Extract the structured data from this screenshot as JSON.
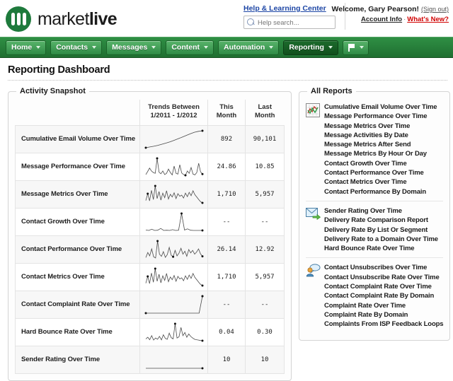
{
  "header": {
    "logo_text_light": "market",
    "logo_text_bold": "live",
    "logo_icon": "marketlive-circle-logo",
    "help_link": "Help & Learning Center",
    "help_search_placeholder": "Help search...",
    "help_search_value": "",
    "welcome": "Welcome, Gary Pearson!",
    "sign_out": "(Sign out)",
    "account_info": "Account Info",
    "separator": "·",
    "whats_new": "What's New?",
    "accent_green": "#1e7a3c",
    "link_blue": "#1d46a5",
    "alert_red": "#d00000"
  },
  "nav": {
    "items": [
      {
        "label": "Home",
        "active": false
      },
      {
        "label": "Contacts",
        "active": false
      },
      {
        "label": "Messages",
        "active": false
      },
      {
        "label": "Content",
        "active": false
      },
      {
        "label": "Automation",
        "active": false
      },
      {
        "label": "Reporting",
        "active": true
      }
    ],
    "flag_button": {
      "icon": "flag-icon",
      "label": ""
    }
  },
  "page": {
    "title": "Reporting Dashboard"
  },
  "activity_snapshot": {
    "legend": "Activity Snapshot",
    "columns": [
      "",
      "Trends Between 1/2011 - 1/2012",
      "This Month",
      "Last Month"
    ],
    "column_trend_line1": "Trends Between",
    "column_trend_line2": "1/2011 - 1/2012",
    "column_this_month": "This Month",
    "column_last_month": "Last Month",
    "rows": [
      {
        "name": "Cumulative Email Volume Over Time",
        "this_month": "892",
        "last_month": "90,101"
      },
      {
        "name": "Message Performance Over Time",
        "this_month": "24.86",
        "last_month": "10.85"
      },
      {
        "name": "Message Metrics Over Time",
        "this_month": "1,710",
        "last_month": "5,957"
      },
      {
        "name": "Contact Growth Over Time",
        "this_month": "--",
        "last_month": "--"
      },
      {
        "name": "Contact Performance Over Time",
        "this_month": "26.14",
        "last_month": "12.92"
      },
      {
        "name": "Contact Metrics Over Time",
        "this_month": "1,710",
        "last_month": "5,957"
      },
      {
        "name": "Contact Complaint Rate Over Time",
        "this_month": "--",
        "last_month": "--"
      },
      {
        "name": "Hard Bounce Rate Over Time",
        "this_month": "0.04",
        "last_month": "0.30"
      },
      {
        "name": "Sender Rating Over Time",
        "this_month": "10",
        "last_month": "10"
      }
    ]
  },
  "chart_data": [
    {
      "type": "line",
      "title": "Cumulative Email Volume Over Time",
      "xlabel": "",
      "ylabel": "",
      "values": [
        5,
        9,
        13,
        18,
        24,
        30,
        37,
        45,
        53,
        62,
        71,
        80,
        88,
        93,
        96
      ],
      "markers": {
        "first": 0,
        "last": 14
      }
    },
    {
      "type": "line",
      "title": "Message Performance Over Time",
      "values": [
        12,
        28,
        45,
        30,
        22,
        18,
        95,
        24,
        16,
        30,
        12,
        18,
        40,
        22,
        10,
        55,
        18,
        14,
        62,
        20,
        12,
        8,
        30,
        18,
        48,
        14,
        10,
        22,
        70,
        26,
        14
      ],
      "markers": {
        "max": 6,
        "min": 21,
        "last": 30
      }
    },
    {
      "type": "line",
      "title": "Message Metrics Over Time",
      "values": [
        20,
        55,
        18,
        72,
        25,
        95,
        30,
        66,
        22,
        58,
        35,
        70,
        28,
        52,
        38,
        60,
        30,
        55,
        42,
        48,
        33,
        58,
        40,
        62,
        45,
        70,
        50,
        38,
        25,
        14,
        8
      ],
      "markers": {
        "max": 5,
        "min": 1,
        "last": 30
      }
    },
    {
      "type": "line",
      "title": "Contact Growth Over Time",
      "values": [
        4,
        2,
        8,
        2,
        3,
        12,
        2,
        3,
        2,
        6,
        2,
        3,
        88,
        4,
        10,
        3,
        2,
        2,
        2,
        2
      ],
      "markers": {
        "max": 12,
        "last": 19
      }
    },
    {
      "type": "line",
      "title": "Contact Performance Over Time",
      "values": [
        14,
        38,
        22,
        55,
        18,
        12,
        92,
        30,
        20,
        42,
        15,
        28,
        62,
        25,
        18,
        48,
        22,
        35,
        58,
        30,
        44,
        20,
        52,
        36,
        48,
        30,
        40,
        55,
        32,
        20
      ],
      "markers": {
        "max": 6,
        "min": 14,
        "last": 29
      }
    },
    {
      "type": "line",
      "title": "Contact Metrics Over Time",
      "values": [
        20,
        55,
        18,
        72,
        25,
        95,
        30,
        66,
        22,
        58,
        35,
        70,
        28,
        52,
        38,
        60,
        30,
        55,
        42,
        48,
        33,
        58,
        40,
        62,
        45,
        70,
        50,
        38,
        25,
        14,
        8
      ],
      "markers": {
        "max": 5,
        "min": 1,
        "last": 30
      }
    },
    {
      "type": "line",
      "title": "Contact Complaint Rate Over Time",
      "values": [
        2,
        2,
        2,
        2,
        2,
        2,
        2,
        2,
        2,
        2,
        2,
        2,
        2,
        2,
        2,
        2,
        2,
        95
      ],
      "markers": {
        "first": 0,
        "max": 17,
        "last": 17
      }
    },
    {
      "type": "line",
      "title": "Hard Bounce Rate Over Time",
      "values": [
        14,
        22,
        10,
        30,
        8,
        18,
        12,
        26,
        9,
        34,
        16,
        12,
        42,
        20,
        14,
        88,
        18,
        24,
        70,
        30,
        45,
        22,
        38,
        26,
        18,
        12,
        10,
        8,
        6,
        5
      ],
      "markers": {
        "max": 15,
        "last": 29
      }
    },
    {
      "type": "line",
      "title": "Sender Rating Over Time",
      "values": [
        50,
        50,
        50,
        50,
        50,
        50,
        50,
        50,
        50,
        50,
        50
      ],
      "markers": {
        "last": 10
      }
    }
  ],
  "all_reports": {
    "legend": "All Reports",
    "groups": [
      {
        "icon": "chart-report-icon",
        "links": [
          "Cumulative Email Volume Over Time",
          "Message Performance Over Time",
          "Message Metrics Over Time",
          "Message Activities By Date",
          "Message Metrics After Send",
          "Message Metrics By Hour Or Day",
          "Contact Growth Over Time",
          "Contact Performance Over Time",
          "Contact Metrics Over Time",
          "Contact Performance By Domain"
        ]
      },
      {
        "icon": "envelope-send-icon",
        "links": [
          "Sender Rating Over Time",
          "Delivery Rate Comparison Report",
          "Delivery Rate By List Or Segment",
          "Delivery Rate to a Domain Over Time",
          "Hard Bounce Rate Over Time"
        ]
      },
      {
        "icon": "user-comment-icon",
        "links": [
          "Contact Unsubscribes Over Time",
          "Contact Unsubscribe Rate Over Time",
          "Contact Complaint Rate Over Time",
          "Contact Complaint Rate By Domain",
          "Complaint Rate Over Time",
          "Complaint Rate By Domain",
          "Complaints From ISP Feedback Loops"
        ]
      }
    ]
  }
}
